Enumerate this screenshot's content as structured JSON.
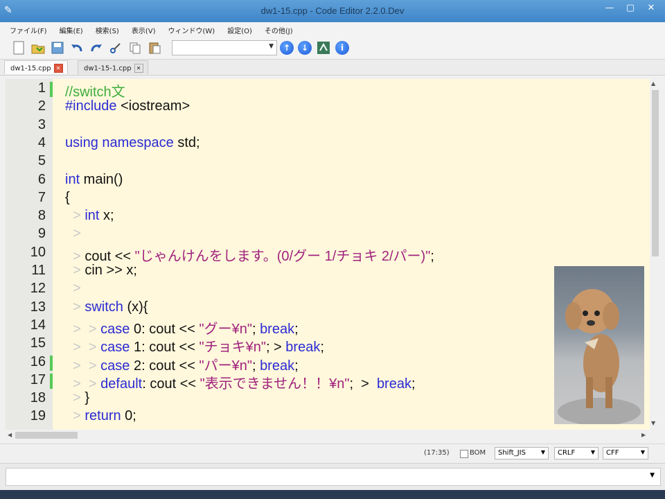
{
  "window": {
    "title": "dw1-15.cpp - Code Editor 2.2.0.Dev",
    "controls": [
      "—",
      "▢",
      "✕"
    ]
  },
  "menu": [
    "ファイル(F)",
    "編集(E)",
    "検索(S)",
    "表示(V)",
    "ウィンドウ(W)",
    "設定(O)",
    "その他(J)"
  ],
  "toolbar": {
    "icons": [
      "new-file-icon",
      "open-file-icon",
      "save-icon",
      "undo-icon",
      "redo-icon",
      "cut-icon",
      "copy-icon",
      "paste-icon"
    ],
    "search_value": "",
    "buttons": [
      "find-prev-icon",
      "find-next-icon",
      "replace-icon",
      "help-icon"
    ]
  },
  "tabs": [
    {
      "label": "dw1-15.cpp",
      "active": true
    },
    {
      "label": "dw1-15-1.cpp",
      "active": false
    }
  ],
  "code": {
    "line_numbers": [
      "1",
      "2",
      "3",
      "4",
      "5",
      "6",
      "7",
      "8",
      "9",
      "10",
      "11",
      "12",
      "13",
      "14",
      "15",
      "16",
      "17",
      "18",
      "19"
    ],
    "lines": [
      [
        {
          "t": "//switch文",
          "c": "cm"
        }
      ],
      [
        {
          "t": "#include",
          "c": "kw"
        },
        {
          "t": " <iostream>",
          "c": ""
        }
      ],
      [],
      [
        {
          "t": "using namespace",
          "c": "kw"
        },
        {
          "t": " std;",
          "c": ""
        }
      ],
      [],
      [
        {
          "t": "int",
          "c": "kw"
        },
        {
          "t": " main()",
          "c": ""
        }
      ],
      [
        {
          "t": "{",
          "c": ""
        }
      ],
      [
        {
          "t": "  > ",
          "c": "ws"
        },
        {
          "t": "int",
          "c": "kw"
        },
        {
          "t": " x;",
          "c": ""
        }
      ],
      [
        {
          "t": "  > ",
          "c": "ws"
        }
      ],
      [
        {
          "t": "  > ",
          "c": "ws"
        },
        {
          "t": "cout << ",
          "c": ""
        },
        {
          "t": "\"じゃんけんをします。(0/グー 1/チョキ 2/パー)\"",
          "c": "str"
        },
        {
          "t": ";",
          "c": ""
        }
      ],
      [
        {
          "t": "  > ",
          "c": "ws"
        },
        {
          "t": "cin >> x;",
          "c": ""
        }
      ],
      [
        {
          "t": "  > ",
          "c": "ws"
        }
      ],
      [
        {
          "t": "  > ",
          "c": "ws"
        },
        {
          "t": "switch",
          "c": "kw"
        },
        {
          "t": " (x){",
          "c": ""
        }
      ],
      [
        {
          "t": "  >  > ",
          "c": "ws"
        },
        {
          "t": "case",
          "c": "kw"
        },
        {
          "t": " 0: cout << ",
          "c": ""
        },
        {
          "t": "\"グー¥n\"",
          "c": "str"
        },
        {
          "t": "; ",
          "c": ""
        },
        {
          "t": "break",
          "c": "kw"
        },
        {
          "t": ";",
          "c": ""
        }
      ],
      [
        {
          "t": "  >  > ",
          "c": "ws"
        },
        {
          "t": "case",
          "c": "kw"
        },
        {
          "t": " 1: cout << ",
          "c": ""
        },
        {
          "t": "\"チョキ¥n\"",
          "c": "str"
        },
        {
          "t": "; > ",
          "c": ""
        },
        {
          "t": "break",
          "c": "kw"
        },
        {
          "t": ";",
          "c": ""
        }
      ],
      [
        {
          "t": "  >  > ",
          "c": "ws"
        },
        {
          "t": "case",
          "c": "kw"
        },
        {
          "t": " 2: cout << ",
          "c": ""
        },
        {
          "t": "\"パー¥n\"",
          "c": "str"
        },
        {
          "t": "; ",
          "c": ""
        },
        {
          "t": "break",
          "c": "kw"
        },
        {
          "t": ";",
          "c": ""
        }
      ],
      [
        {
          "t": "  >  > ",
          "c": "ws"
        },
        {
          "t": "default",
          "c": "kw"
        },
        {
          "t": ": cout << ",
          "c": ""
        },
        {
          "t": "\"表示できません！！¥n\"",
          "c": "str"
        },
        {
          "t": ";  >  ",
          "c": ""
        },
        {
          "t": "break",
          "c": "kw"
        },
        {
          "t": ";",
          "c": ""
        }
      ],
      [
        {
          "t": "  > ",
          "c": "ws"
        },
        {
          "t": "}",
          "c": ""
        }
      ],
      [
        {
          "t": "  > ",
          "c": "ws"
        },
        {
          "t": "return",
          "c": "kw"
        },
        {
          "t": " 0;",
          "c": ""
        }
      ]
    ],
    "changed_lines": [
      1,
      16,
      17
    ]
  },
  "status": {
    "position": "(17:35)",
    "bom_label": "BOM",
    "bom_checked": false,
    "encoding": "Shift_JIS",
    "line_ending": "CRLF",
    "mode": "CFF"
  },
  "bottom_input": ""
}
